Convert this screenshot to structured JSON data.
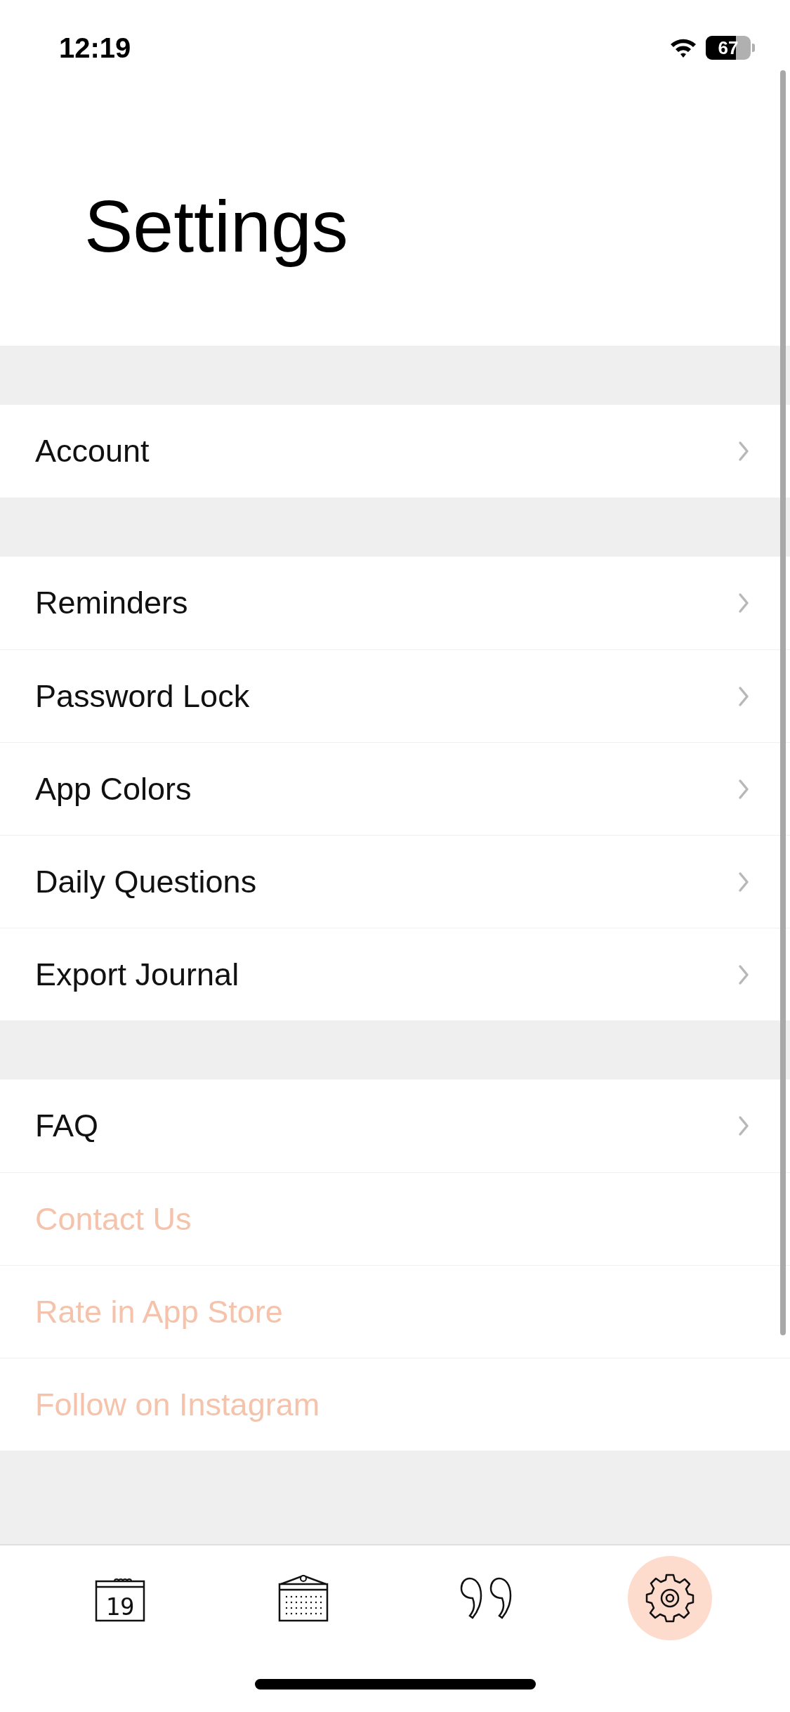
{
  "status_bar": {
    "time": "12:19",
    "battery": "67"
  },
  "title": "Settings",
  "sections": [
    {
      "rows": [
        {
          "label": "Account",
          "kind": "link"
        }
      ]
    },
    {
      "rows": [
        {
          "label": "Reminders",
          "kind": "link"
        },
        {
          "label": "Password Lock",
          "kind": "link"
        },
        {
          "label": "App Colors",
          "kind": "link"
        },
        {
          "label": "Daily Questions",
          "kind": "link"
        },
        {
          "label": "Export Journal",
          "kind": "link"
        }
      ]
    },
    {
      "rows": [
        {
          "label": "FAQ",
          "kind": "link"
        },
        {
          "label": "Contact Us",
          "kind": "action"
        },
        {
          "label": "Rate in App Store",
          "kind": "action"
        },
        {
          "label": "Follow on Instagram",
          "kind": "action"
        }
      ]
    }
  ],
  "tab_bar": [
    {
      "kind": "day",
      "text": "19",
      "selected": false
    },
    {
      "kind": "calendar",
      "selected": false
    },
    {
      "kind": "quote",
      "selected": false
    },
    {
      "kind": "settings",
      "selected": true
    }
  ]
}
